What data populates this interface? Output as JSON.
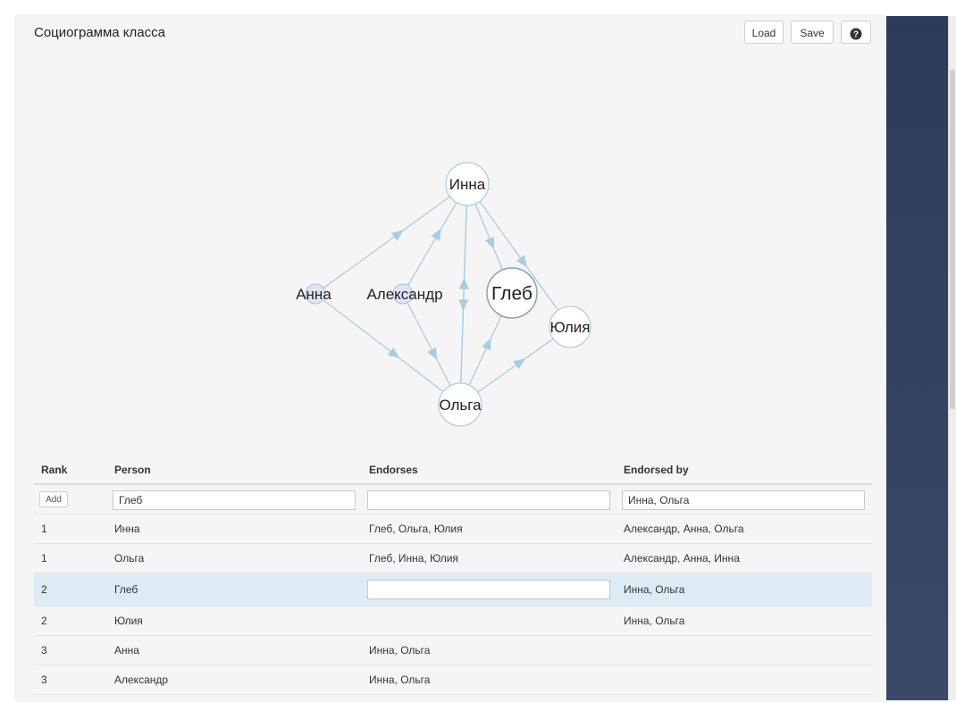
{
  "app": {
    "title": "Социограмма класса",
    "load_label": "Load",
    "save_label": "Save",
    "help_icon": "question-circle-icon"
  },
  "graph": {
    "nodes": [
      {
        "id": "inna",
        "label": "Инна",
        "fill": "#ffffff"
      },
      {
        "id": "anna",
        "label": "Анна",
        "fill": "#e3e3f7"
      },
      {
        "id": "aleksandr",
        "label": "Александр",
        "fill": "#e3e3f7"
      },
      {
        "id": "gleb",
        "label": "Глеб",
        "fill": "#ffffff"
      },
      {
        "id": "yulia",
        "label": "Юлия",
        "fill": "#ffffff"
      },
      {
        "id": "olga",
        "label": "Ольга",
        "fill": "#ffffff"
      }
    ],
    "edges": [
      {
        "from": "anna",
        "to": "inna"
      },
      {
        "from": "anna",
        "to": "olga"
      },
      {
        "from": "aleksandr",
        "to": "inna"
      },
      {
        "from": "aleksandr",
        "to": "olga"
      },
      {
        "from": "inna",
        "to": "gleb"
      },
      {
        "from": "inna",
        "to": "yulia"
      },
      {
        "from": "inna",
        "to": "olga"
      },
      {
        "from": "olga",
        "to": "inna"
      },
      {
        "from": "olga",
        "to": "gleb"
      },
      {
        "from": "olga",
        "to": "yulia"
      }
    ],
    "edge_color": "#a9cce3",
    "node_stroke": "#a9cce3"
  },
  "table": {
    "headers": [
      "Rank",
      "Person",
      "Endorses",
      "Endorsed by"
    ],
    "add_row": {
      "add_label": "Add",
      "person": "Глеб",
      "endorses": "",
      "endorsed_by": "Инна, Ольга"
    },
    "rows": [
      {
        "rank": "1",
        "person": "Инна",
        "endorses": "Глеб, Ольга, Юлия",
        "endorsed_by": "Александр, Анна, Ольга"
      },
      {
        "rank": "1",
        "person": "Ольга",
        "endorses": "Глеб, Инна, Юлия",
        "endorsed_by": "Александр, Анна, Инна"
      },
      {
        "rank": "2",
        "person": "Глеб",
        "endorses": "",
        "endorsed_by": "Инна, Ольга"
      },
      {
        "rank": "2",
        "person": "Юлия",
        "endorses": "",
        "endorsed_by": "Инна, Ольга"
      },
      {
        "rank": "3",
        "person": "Анна",
        "endorses": "Инна, Ольга",
        "endorsed_by": ""
      },
      {
        "rank": "3",
        "person": "Александр",
        "endorses": "Инна, Ольга",
        "endorsed_by": ""
      }
    ],
    "selected_highlight": "#dcebf4"
  }
}
